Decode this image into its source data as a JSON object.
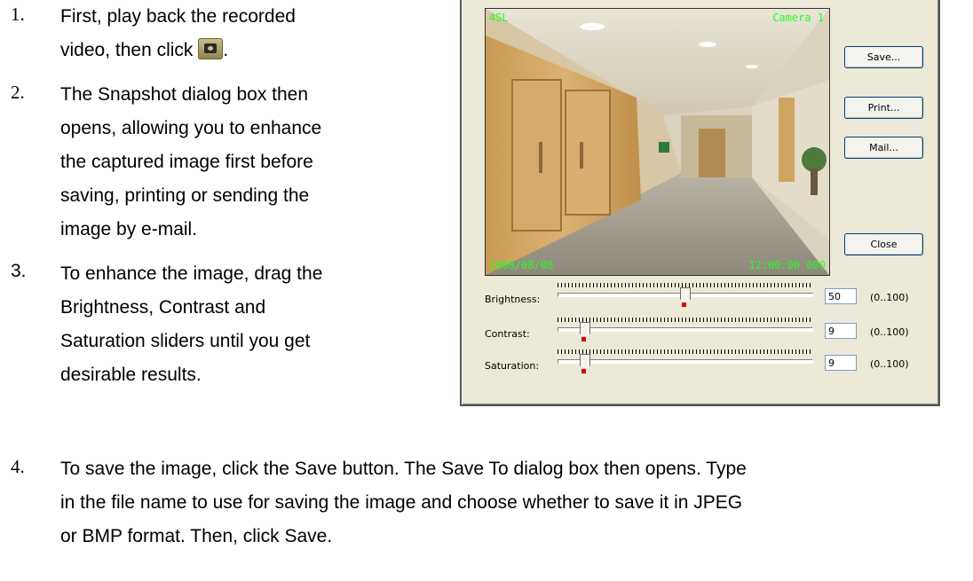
{
  "steps": [
    {
      "number": "1.",
      "lines": [
        "First, play back the recorded",
        "video, then click"
      ],
      "icon": "snapshot-camera-icon"
    },
    {
      "number": "2.",
      "lines": [
        "The Snapshot dialog box then",
        "opens, allowing you to enhance",
        "the captured image first before",
        "saving, printing or sending the",
        "image by e-mail."
      ]
    },
    {
      "number": "3.",
      "lines": [
        "To enhance the image, drag the",
        "Brightness, Contrast and",
        "Saturation sliders until you get",
        "desirable results."
      ]
    },
    {
      "number": "4.",
      "lines": [
        "To save the image, click the Save button. The Save To dialog box then opens. Type",
        "in the file name to use for saving the image and choose whether to save it in JPEG",
        "or BMP format. Then, click Save."
      ]
    }
  ],
  "dialog": {
    "overlay": {
      "top_left": "4SL",
      "top_right": "Camera 1",
      "bottom_left": "2008/08/08",
      "bottom_right": "12:00:00 000"
    },
    "buttons": {
      "save": "Save...",
      "print": "Print...",
      "mail": "Mail...",
      "close": "Close"
    },
    "sliders": [
      {
        "label": "Brightness:",
        "value": "50",
        "range": "(0..100)",
        "level": 0.5
      },
      {
        "label": "Contrast:",
        "value": "9",
        "range": "(0..100)",
        "level": 0.09
      },
      {
        "label": "Saturation:",
        "value": "9",
        "range": "(0..100)",
        "level": 0.09
      }
    ]
  }
}
